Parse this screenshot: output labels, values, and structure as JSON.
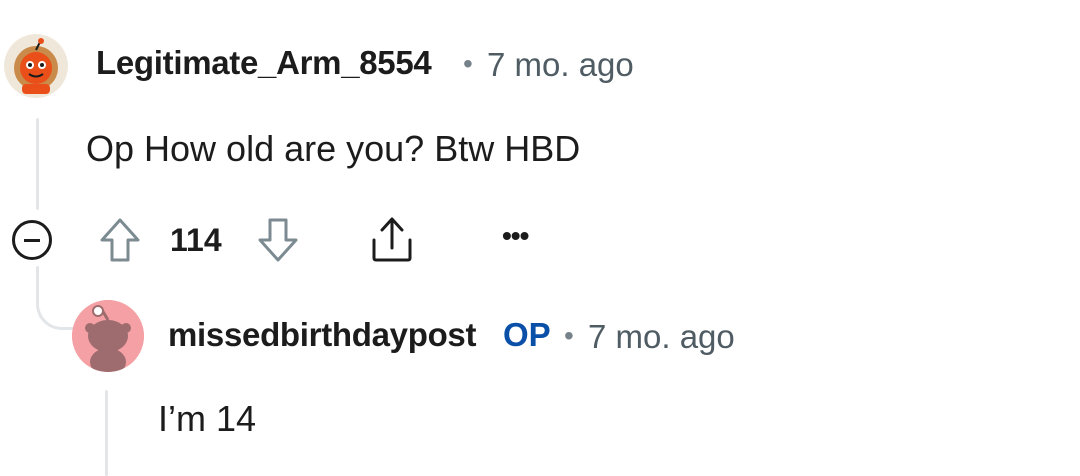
{
  "comment": {
    "author": "Legitimate_Arm_8554",
    "separator": "•",
    "time": "7 mo. ago",
    "body": "Op How old are you? Btw HBD",
    "score": "114",
    "more_label": "•••"
  },
  "reply": {
    "author": "missedbirthdaypost",
    "badge": "OP",
    "separator": "•",
    "time": "7 mo. ago",
    "body": "I’m 14"
  },
  "colors": {
    "op_badge": "#0a4fa8",
    "avatar2_bg": "#f4a0a4",
    "thread_line": "#e2e6e8"
  }
}
